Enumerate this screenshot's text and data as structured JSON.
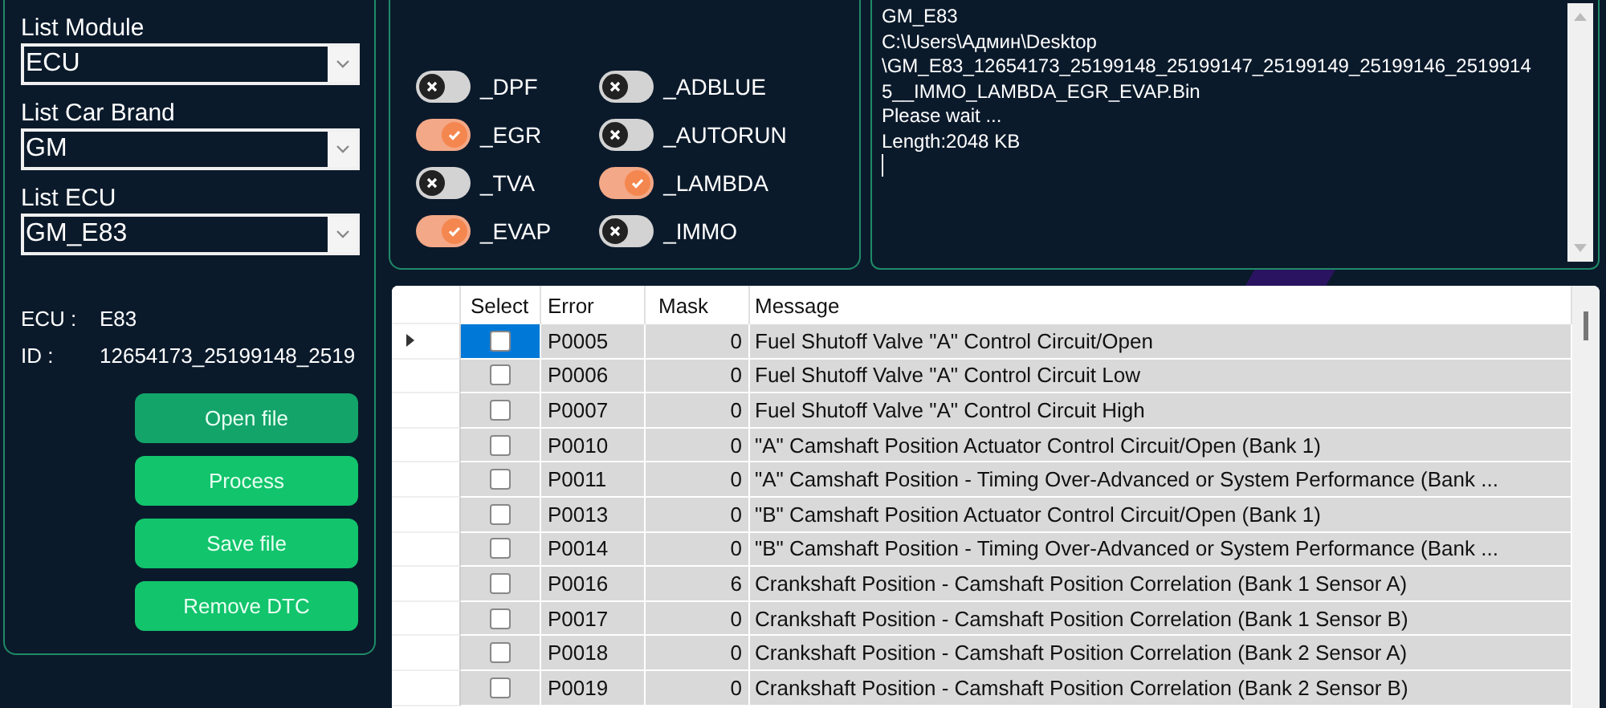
{
  "selectors": [
    {
      "label": "List Module",
      "value": "ECU"
    },
    {
      "label": "List Car Brand",
      "value": "GM"
    },
    {
      "label": "List ECU",
      "value": "GM_E83"
    }
  ],
  "info": [
    {
      "label": "ECU :",
      "value": "E83"
    },
    {
      "label": "ID :",
      "value": "12654173_25199148_2519"
    }
  ],
  "buttons": [
    "Open file",
    "Process",
    "Save file",
    "Remove DTC"
  ],
  "options": [
    {
      "label": "_DPF",
      "on": false
    },
    {
      "label": "_EGR",
      "on": true
    },
    {
      "label": "_TVA",
      "on": false
    },
    {
      "label": "_EVAP",
      "on": true
    },
    {
      "label": "_ADBLUE",
      "on": false
    },
    {
      "label": "_AUTORUN",
      "on": false
    },
    {
      "label": "_LAMBDA",
      "on": true
    },
    {
      "label": "_IMMO",
      "on": false
    }
  ],
  "log": [
    "GM_E83",
    "C:\\Users\\Админ\\Desktop",
    "\\GM_E83_12654173_25199148_25199147_25199149_25199146_2519914",
    "5__IMMO_LAMBDA_EGR_EVAP.Bin",
    "Please wait ...",
    "Length:2048 KB"
  ],
  "table": {
    "columns": [
      "Select",
      "Error",
      "Mask",
      "Message"
    ],
    "rows": [
      {
        "selected": true,
        "checked": false,
        "error": "P0005",
        "mask": "0",
        "message": "Fuel Shutoff Valve \"A\" Control Circuit/Open"
      },
      {
        "selected": false,
        "checked": false,
        "error": "P0006",
        "mask": "0",
        "message": "Fuel Shutoff Valve \"A\" Control Circuit Low"
      },
      {
        "selected": false,
        "checked": false,
        "error": "P0007",
        "mask": "0",
        "message": "Fuel Shutoff Valve \"A\" Control Circuit High"
      },
      {
        "selected": false,
        "checked": false,
        "error": "P0010",
        "mask": "0",
        "message": "\"A\" Camshaft Position Actuator Control Circuit/Open (Bank 1)"
      },
      {
        "selected": false,
        "checked": false,
        "error": "P0011",
        "mask": "0",
        "message": "\"A\" Camshaft Position - Timing Over-Advanced or System Performance (Bank ..."
      },
      {
        "selected": false,
        "checked": false,
        "error": "P0013",
        "mask": "0",
        "message": "\"B\" Camshaft Position Actuator Control Circuit/Open (Bank 1)"
      },
      {
        "selected": false,
        "checked": false,
        "error": "P0014",
        "mask": "0",
        "message": "\"B\" Camshaft Position - Timing Over-Advanced or System Performance (Bank ..."
      },
      {
        "selected": false,
        "checked": false,
        "error": "P0016",
        "mask": "6",
        "message": "Crankshaft Position - Camshaft Position Correlation (Bank 1 Sensor A)"
      },
      {
        "selected": false,
        "checked": false,
        "error": "P0017",
        "mask": "0",
        "message": "Crankshaft Position - Camshaft Position Correlation (Bank 1 Sensor B)"
      },
      {
        "selected": false,
        "checked": false,
        "error": "P0018",
        "mask": "0",
        "message": "Crankshaft Position - Camshaft Position Correlation (Bank 2 Sensor A)"
      },
      {
        "selected": false,
        "checked": false,
        "error": "P0019",
        "mask": "0",
        "message": "Crankshaft Position - Camshaft Position Correlation (Bank 2 Sensor B)"
      }
    ]
  }
}
